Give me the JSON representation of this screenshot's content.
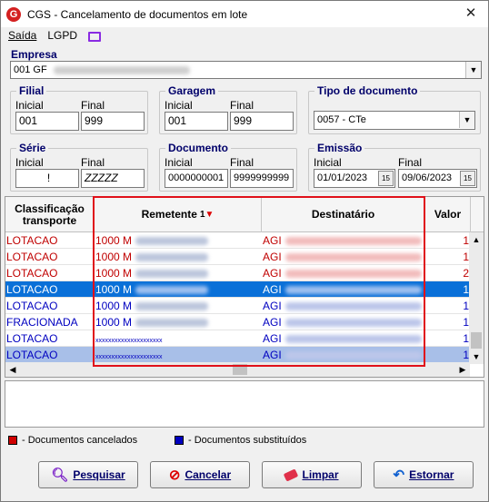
{
  "window": {
    "title": "CGS - Cancelamento de documentos em lote",
    "close_glyph": "✕"
  },
  "menu": {
    "items": [
      "Saída",
      "LGPD"
    ]
  },
  "empresa": {
    "label": "Empresa",
    "value": "001 GF"
  },
  "filial": {
    "label": "Filial",
    "inicial_label": "Inicial",
    "final_label": "Final",
    "inicial": "001",
    "final": "999"
  },
  "garagem": {
    "label": "Garagem",
    "inicial_label": "Inicial",
    "final_label": "Final",
    "inicial": "001",
    "final": "999"
  },
  "tipo_documento": {
    "label": "Tipo de documento",
    "value": "0057 - CTe"
  },
  "serie": {
    "label": "Série",
    "inicial_label": "Inicial",
    "final_label": "Final",
    "inicial": "!",
    "final": "ZZZZZ"
  },
  "documento": {
    "label": "Documento",
    "inicial_label": "Inicial",
    "final_label": "Final",
    "inicial": "0000000001",
    "final": "9999999999"
  },
  "emissao": {
    "label": "Emissão",
    "inicial_label": "Inicial",
    "final_label": "Final",
    "inicial": "01/01/2023",
    "final": "09/06/2023",
    "cal_glyph": "15"
  },
  "grid": {
    "columns": [
      "Classificação transporte",
      "Remetente",
      "Destinatário",
      "Valor"
    ],
    "sort_index": "1",
    "rows": [
      {
        "classificacao": "LOTACAO",
        "remetente": "1000 M",
        "destinatario": "AGI",
        "valor": "1",
        "style": "red"
      },
      {
        "classificacao": "LOTACAO",
        "remetente": "1000 M",
        "destinatario": "AGI",
        "valor": "1",
        "style": "red"
      },
      {
        "classificacao": "LOTACAO",
        "remetente": "1000 M",
        "destinatario": "AGI",
        "valor": "2",
        "style": "red"
      },
      {
        "classificacao": "LOTACAO",
        "remetente": "1000 M",
        "destinatario": "AGI",
        "valor": "1",
        "style": "selected"
      },
      {
        "classificacao": "LOTACAO",
        "remetente": "1000 M",
        "destinatario": "AGI",
        "valor": "1",
        "style": "blue"
      },
      {
        "classificacao": "FRACIONADA",
        "remetente": "1000 M",
        "destinatario": "AGI",
        "valor": "1",
        "style": "blue"
      },
      {
        "classificacao": "LOTACAO",
        "remetente": "xxxxxxxxxxxxxxxxxxxxx",
        "destinatario": "AGI",
        "valor": "1",
        "style": "blue"
      },
      {
        "classificacao": "LOTACAO",
        "remetente": "xxxxxxxxxxxxxxxxxxxxx",
        "destinatario": "AGI",
        "valor": "1",
        "style": "selected-light"
      }
    ]
  },
  "legend": {
    "cancelados": "- Documentos cancelados",
    "substituidos": "- Documentos substituídos"
  },
  "buttons": {
    "pesquisar": "Pesquisar",
    "cancelar": "Cancelar",
    "limpar": "Limpar",
    "estornar": "Estornar"
  },
  "colors": {
    "cancel": "#c00000",
    "substituted": "#0000c0",
    "selected": "#0a70d8",
    "accent_label": "#00006a",
    "highlight_box": "#e0101a"
  }
}
